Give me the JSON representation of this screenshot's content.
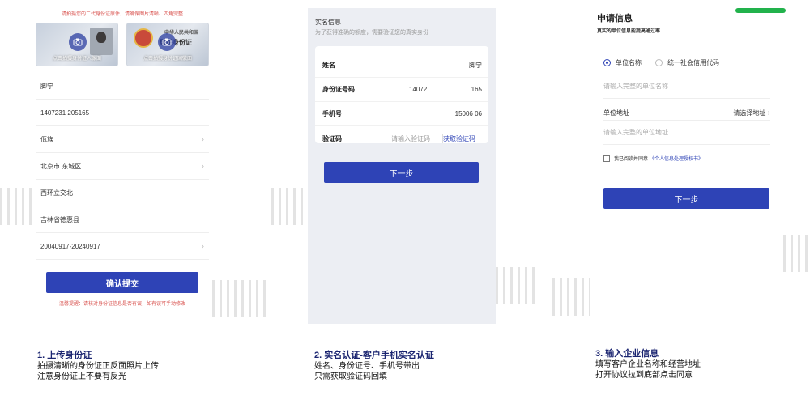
{
  "panel1": {
    "hint_top": "请拍摄您的二代身份证原件，请确保图片清晰、四角完整",
    "front_card_label": "点击拍摄身份证人像面",
    "back_card_title": "中华人民共和国",
    "back_card_subtitle": "居民身份证",
    "back_card_label": "点击拍摄身份证国徽面",
    "fields": [
      {
        "value": "脚宁",
        "chevron": false
      },
      {
        "value": "1407231          205165",
        "chevron": false
      },
      {
        "value": "佤族",
        "chevron": true
      },
      {
        "value": "北京市 东城区",
        "chevron": true
      },
      {
        "value": "西环立交北",
        "chevron": false
      },
      {
        "value": "吉林省德惠县",
        "chevron": false
      },
      {
        "value": "20040917-20240917",
        "chevron": true
      }
    ],
    "chevron_glyph": "›",
    "submit_label": "确认提交",
    "hint_bottom": "温馨提醒：请核对身份证信息是否有误，如有误可手动修改"
  },
  "panel2": {
    "title": "实名信息",
    "subtitle": "为了获得准确的额度，需要验证您的真实身份",
    "rows": {
      "name_label": "姓名",
      "name_value": "脚宁",
      "id_label": "身份证号码",
      "id_value_part1": "14072",
      "id_value_part2": "165",
      "phone_label": "手机号",
      "phone_value": "15006      06",
      "code_label": "验证码",
      "code_placeholder": "请输入验证码",
      "code_link": "获取验证码"
    },
    "next_label": "下一步"
  },
  "panel3": {
    "title": "申请信息",
    "subtitle": "真实的单位信息能提高通过率",
    "radio_option1": "单位名称",
    "radio_option2": "统一社会信用代码",
    "company_placeholder": "请输入完整的单位名称",
    "address_label": "单位地址",
    "address_select": "请选择地址",
    "address_chevron": "›",
    "address_placeholder": "请输入完整的单位地址",
    "agree_text": "我已阅读并同意",
    "agree_link": "《个人信息处理授权书》",
    "next_label": "下一步"
  },
  "captions": [
    {
      "heading": "1. 上传身份证",
      "line1": "拍摄清晰的身份证正反面照片上传",
      "line2": "注意身份证上不要有反光"
    },
    {
      "heading": "2. 实名认证-客户手机实名认证",
      "line1": "姓名、身份证号、手机号带出",
      "line2": "只需获取验证码回填"
    },
    {
      "heading": "3. 输入企业信息",
      "line1": "填写客户企业名称和经营地址",
      "line2": "打开协议拉到底部点击同意"
    }
  ],
  "colors": {
    "accent": "#2e43b6",
    "hint_red": "#d9534f",
    "panel2_bg": "#eceef3",
    "status_green": "#22b24c"
  },
  "icons": [
    "camera-icon",
    "chevron-right-icon",
    "radio-icon",
    "checkbox-icon"
  ]
}
